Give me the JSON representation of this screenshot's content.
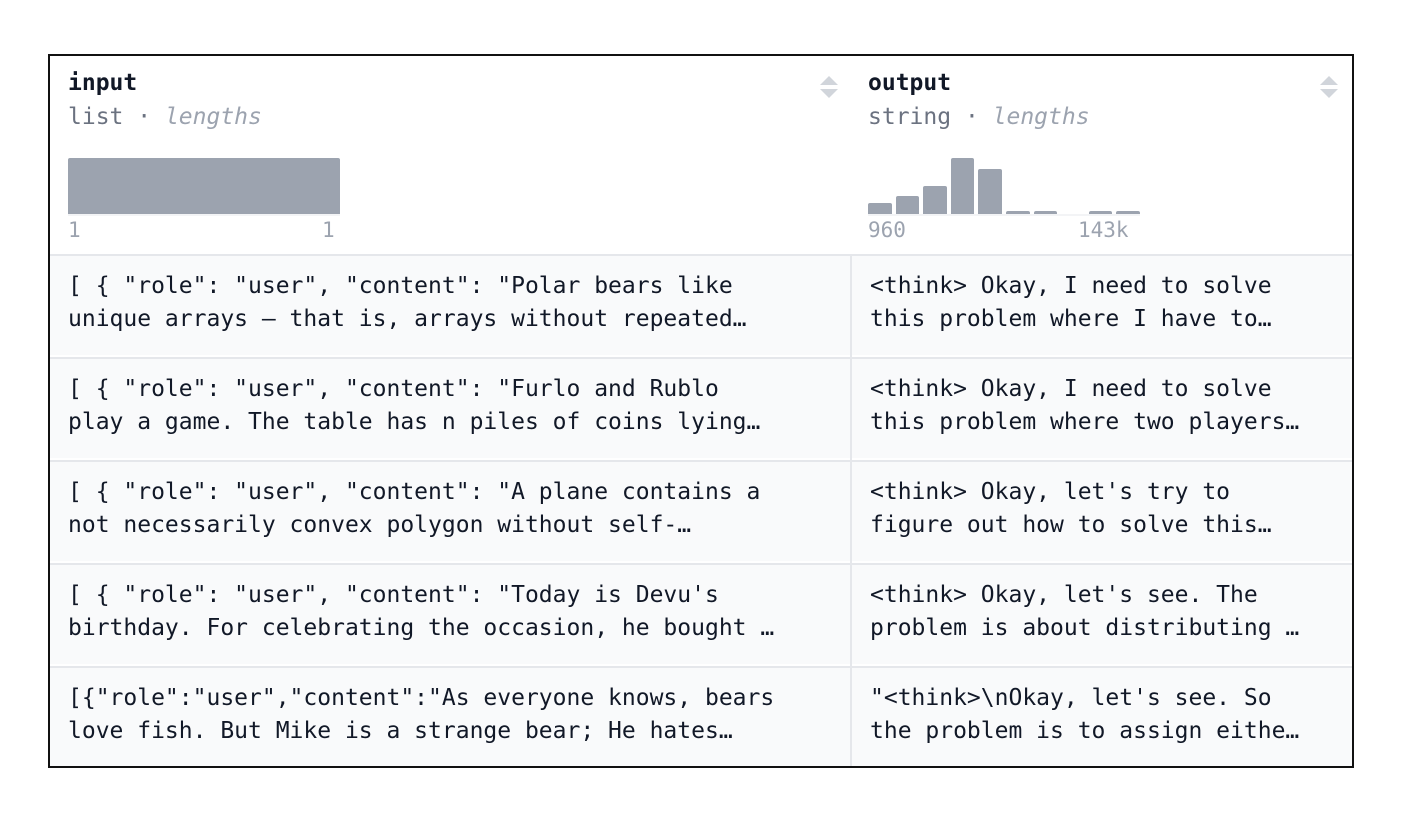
{
  "columns": [
    {
      "name": "input",
      "type": "list",
      "sub": "lengths",
      "sort_icon": "sort-icon",
      "histogram": {
        "bars": [
          1.0
        ],
        "min_label": "1",
        "max_label": "1"
      }
    },
    {
      "name": "output",
      "type": "string",
      "sub": "lengths",
      "sort_icon": "sort-icon",
      "histogram": {
        "bars": [
          0.2,
          0.32,
          0.5,
          1.0,
          0.8,
          0.05,
          0.05,
          0,
          0.05,
          0.05
        ],
        "min_label": "960",
        "max_label": "143k"
      }
    }
  ],
  "rows": [
    {
      "input": [
        "[ { \"role\": \"user\", \"content\": \"Polar bears like",
        "unique arrays — that is, arrays without repeated…"
      ],
      "output": [
        "<think> Okay, I need to solve",
        "this problem where I have to…"
      ]
    },
    {
      "input": [
        "[ { \"role\": \"user\", \"content\": \"Furlo and Rublo",
        "play a game. The table has n piles of coins lying…"
      ],
      "output": [
        "<think> Okay, I need to solve",
        "this problem where two players…"
      ]
    },
    {
      "input": [
        "[ { \"role\": \"user\", \"content\": \"A plane contains a",
        "not necessarily convex polygon without self-…"
      ],
      "output": [
        "<think> Okay, let's try to",
        "figure out how to solve this…"
      ]
    },
    {
      "input": [
        "[ { \"role\": \"user\", \"content\": \"Today is Devu's",
        "birthday. For celebrating the occasion, he bought …"
      ],
      "output": [
        "<think> Okay, let's see. The",
        "problem is about distributing …"
      ]
    },
    {
      "input": [
        "[{\"role\":\"user\",\"content\":\"As everyone knows, bears",
        "love fish. But Mike is a strange bear; He hates…"
      ],
      "output": [
        "\"<think>\\nOkay, let's see. So",
        "the problem is to assign eithe…"
      ]
    }
  ]
}
